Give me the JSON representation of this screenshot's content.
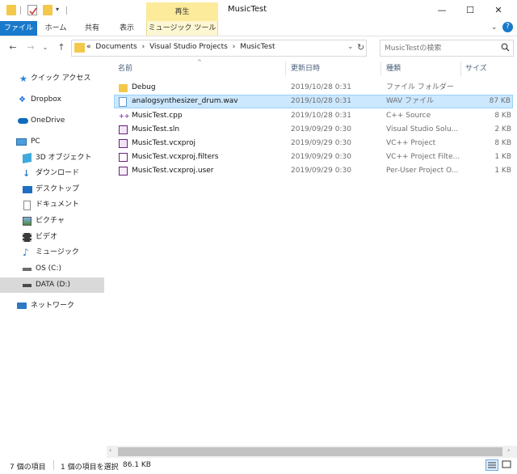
{
  "window": {
    "title": "MusicTest",
    "context_tab_group": "再生",
    "minimize": "—",
    "maximize": "☐",
    "close": "✕"
  },
  "ribbon": {
    "tabs": [
      {
        "label": "ファイル",
        "active": true
      },
      {
        "label": "ホーム"
      },
      {
        "label": "共有"
      },
      {
        "label": "表示"
      },
      {
        "label": "ミュージック ツール"
      }
    ]
  },
  "address": {
    "path": [
      "«",
      "Documents",
      "›",
      "Visual Studio Projects",
      "›",
      "MusicTest"
    ],
    "search_placeholder": "MusicTestの検索"
  },
  "nav": {
    "items": [
      {
        "label": "クイック アクセス",
        "icon": "star-icon",
        "color": "#2a7fd4"
      },
      {
        "label": "Dropbox",
        "icon": "dropbox-icon",
        "color": "#1e6fd9"
      },
      {
        "label": "OneDrive",
        "icon": "cloud-icon",
        "color": "#0f6cbd"
      },
      {
        "label": "PC",
        "icon": "computer-icon",
        "color": "#4a9ee0"
      },
      {
        "label": "3D オブジェクト",
        "icon": "cube-icon",
        "color": "#3fa9dc"
      },
      {
        "label": "ダウンロード",
        "icon": "download-icon",
        "color": "#2f78c4"
      },
      {
        "label": "デスクトップ",
        "icon": "desktop-icon",
        "color": "#1f6fc2"
      },
      {
        "label": "ドキュメント",
        "icon": "document-icon",
        "color": "#8a8a8a"
      },
      {
        "label": "ピクチャ",
        "icon": "pictures-icon",
        "color": "#3c7bc9"
      },
      {
        "label": "ビデオ",
        "icon": "video-icon",
        "color": "#3a3a3a"
      },
      {
        "label": "ミュージック",
        "icon": "music-icon",
        "color": "#2e7fd0"
      },
      {
        "label": "OS (C:)",
        "icon": "drive-icon",
        "color": "#6b6b6b"
      },
      {
        "label": "DATA (D:)",
        "icon": "drive-icon",
        "color": "#6b6b6b",
        "selected": true
      },
      {
        "label": "ネットワーク",
        "icon": "network-icon",
        "color": "#2f78c4"
      }
    ]
  },
  "columns": {
    "name": "名前",
    "date": "更新日時",
    "type": "種類",
    "size": "サイズ"
  },
  "files": [
    {
      "name": "Debug",
      "date": "2019/10/28 0:31",
      "type": "ファイル フォルダー",
      "size": "",
      "icon": "folder-icon",
      "color": "#f3c84b"
    },
    {
      "name": "analogsynthesizer_drum.wav",
      "date": "2019/10/28 0:31",
      "type": "WAV ファイル",
      "size": "87 KB",
      "icon": "audio-file-icon",
      "color": "#5b9bd5",
      "selected": true
    },
    {
      "name": "MusicTest.cpp",
      "date": "2019/10/28 0:31",
      "type": "C++ Source",
      "size": "8 KB",
      "icon": "cpp-file-icon",
      "color": "#8e44ad"
    },
    {
      "name": "MusicTest.sln",
      "date": "2019/09/29 0:30",
      "type": "Visual Studio Solu...",
      "size": "2 KB",
      "icon": "solution-file-icon",
      "color": "#68217a"
    },
    {
      "name": "MusicTest.vcxproj",
      "date": "2019/09/29 0:30",
      "type": "VC++ Project",
      "size": "8 KB",
      "icon": "vcxproj-file-icon",
      "color": "#68217a"
    },
    {
      "name": "MusicTest.vcxproj.filters",
      "date": "2019/09/29 0:30",
      "type": "VC++ Project Filte...",
      "size": "1 KB",
      "icon": "filters-file-icon",
      "color": "#68217a"
    },
    {
      "name": "MusicTest.vcxproj.user",
      "date": "2019/09/29 0:30",
      "type": "Per-User Project O...",
      "size": "1 KB",
      "icon": "user-file-icon",
      "color": "#68217a"
    }
  ],
  "status": {
    "item_count": "7 個の項目",
    "selection": "1 個の項目を選択",
    "selection_size": "86.1 KB"
  }
}
